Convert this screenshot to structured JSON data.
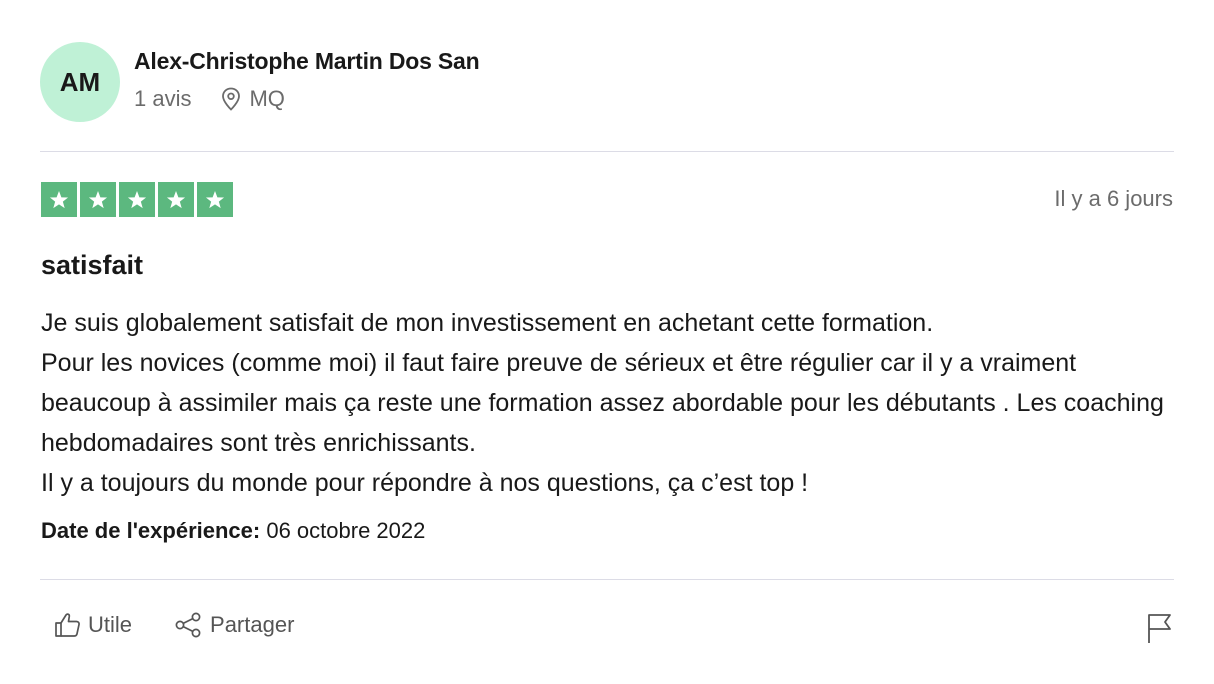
{
  "author": {
    "initials": "AM",
    "name": "Alex-Christophe Martin Dos San",
    "reviews_count": "1 avis",
    "country": "MQ",
    "avatar_color": "#bff1d6"
  },
  "review": {
    "rating": 5,
    "rating_max": 5,
    "star_color": "#5cb87f",
    "posted_ago": "Il y a 6 jours",
    "title": "satisfait",
    "body_lines": [
      "Je suis globalement satisfait de mon investissement en achetant cette formation.",
      "Pour les novices (comme moi) il faut faire preuve de sérieux et être régulier car il y a vraiment beaucoup à assimiler mais ça reste une formation assez abordable pour les débutants . Les coaching hebdomadaires sont très enrichissants.",
      "Il y a toujours du monde pour répondre à nos questions, ça c’est top !"
    ],
    "experience_label": "Date de l'expérience:",
    "experience_date": "06 octobre 2022"
  },
  "actions": {
    "useful_label": "Utile",
    "share_label": "Partager",
    "useful_icon": "thumbs-up-icon",
    "share_icon": "share-icon",
    "report_icon": "flag-icon"
  }
}
